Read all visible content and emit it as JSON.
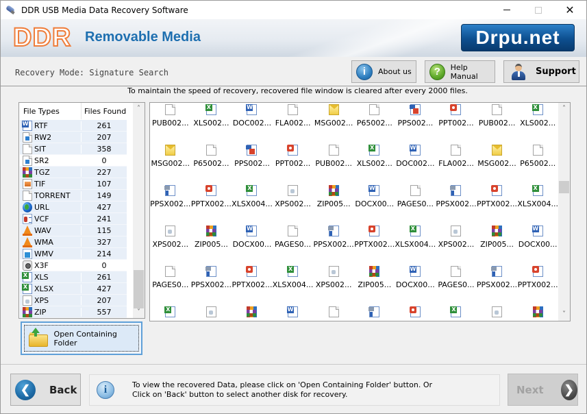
{
  "window": {
    "title": "DDR USB Media Data Recovery Software",
    "controls": {
      "minimize": "minimize",
      "maximize": "maximize",
      "close": "✕"
    }
  },
  "banner": {
    "logo": "DDR",
    "product": "Removable Media",
    "badge": "Drpu.net",
    "colors": {
      "logo_orange": "#ef7d3a",
      "product_blue": "#1e6fb0",
      "badge_blue": "#0d4f8f"
    }
  },
  "mode": {
    "label": "Recovery Mode: Signature Search"
  },
  "toolbar": {
    "about_label": "About us",
    "help_label": "Help Manual",
    "support_label": "Support",
    "about_icon": "i",
    "help_icon": "?"
  },
  "notice": "To maintain the speed of recovery, recovered file window is cleared after every 2000 files.",
  "file_types": {
    "headers": {
      "type": "File Types",
      "count": "Files Found"
    },
    "rows": [
      {
        "type": "RTF",
        "count": "261",
        "icon": "word"
      },
      {
        "type": "RW2",
        "count": "207",
        "icon": "raw"
      },
      {
        "type": "SIT",
        "count": "358",
        "icon": "generic"
      },
      {
        "type": "SR2",
        "count": "0",
        "icon": "raw"
      },
      {
        "type": "TGZ",
        "count": "227",
        "icon": "archive"
      },
      {
        "type": "TIF",
        "count": "107",
        "icon": "image"
      },
      {
        "type": "TORRENT",
        "count": "149",
        "icon": "generic"
      },
      {
        "type": "URL",
        "count": "427",
        "icon": "globe"
      },
      {
        "type": "VCF",
        "count": "241",
        "icon": "vcard"
      },
      {
        "type": "WAV",
        "count": "115",
        "icon": "vlc"
      },
      {
        "type": "WMA",
        "count": "327",
        "icon": "vlc"
      },
      {
        "type": "WMV",
        "count": "214",
        "icon": "video"
      },
      {
        "type": "X3F",
        "count": "0",
        "icon": "camera-raw"
      },
      {
        "type": "XLS",
        "count": "261",
        "icon": "excel"
      },
      {
        "type": "XLSX",
        "count": "427",
        "icon": "excel"
      },
      {
        "type": "XPS",
        "count": "207",
        "icon": "xps"
      },
      {
        "type": "ZIP",
        "count": "557",
        "icon": "archive"
      }
    ],
    "scroll_up": "^",
    "scroll_down": "v"
  },
  "open_folder_label": "Open Containing Folder",
  "recovered_files": [
    {
      "name": "PUB002...",
      "icon": "generic"
    },
    {
      "name": "XLS002...",
      "icon": "excel"
    },
    {
      "name": "DOC002...",
      "icon": "word"
    },
    {
      "name": "FLA002...",
      "icon": "generic"
    },
    {
      "name": "MSG002...",
      "icon": "mail"
    },
    {
      "name": "P65002...",
      "icon": "generic"
    },
    {
      "name": "PPS002...",
      "icon": "pps"
    },
    {
      "name": "PPT002...",
      "icon": "ppt"
    },
    {
      "name": "PUB002...",
      "icon": "generic"
    },
    {
      "name": "XLS002...",
      "icon": "excel"
    },
    {
      "name": "MSG002...",
      "icon": "mail"
    },
    {
      "name": "P65002...",
      "icon": "generic"
    },
    {
      "name": "PPS002...",
      "icon": "pps"
    },
    {
      "name": "PPT002...",
      "icon": "ppt"
    },
    {
      "name": "PUB002...",
      "icon": "generic"
    },
    {
      "name": "XLS002...",
      "icon": "excel"
    },
    {
      "name": "DOC002...",
      "icon": "word"
    },
    {
      "name": "FLA002...",
      "icon": "generic"
    },
    {
      "name": "MSG002...",
      "icon": "mail"
    },
    {
      "name": "P65002...",
      "icon": "generic"
    },
    {
      "name": "PPSX002...",
      "icon": "ppsx"
    },
    {
      "name": "PPTX002...",
      "icon": "ppt"
    },
    {
      "name": "XLSX004...",
      "icon": "excel"
    },
    {
      "name": "XPS002...",
      "icon": "xps"
    },
    {
      "name": "ZIP005...",
      "icon": "archive"
    },
    {
      "name": "DOCX00...",
      "icon": "word"
    },
    {
      "name": "PAGES0...",
      "icon": "generic"
    },
    {
      "name": "PPSX002...",
      "icon": "ppsx"
    },
    {
      "name": "PPTX002...",
      "icon": "ppt"
    },
    {
      "name": "XLSX004...",
      "icon": "excel"
    },
    {
      "name": "XPS002...",
      "icon": "xps"
    },
    {
      "name": "ZIP005...",
      "icon": "archive"
    },
    {
      "name": "DOCX00...",
      "icon": "word"
    },
    {
      "name": "PAGES0...",
      "icon": "generic"
    },
    {
      "name": "PPSX002...",
      "icon": "ppsx"
    },
    {
      "name": "PPTX002...",
      "icon": "ppt"
    },
    {
      "name": "XLSX004...",
      "icon": "excel"
    },
    {
      "name": "XPS002...",
      "icon": "xps"
    },
    {
      "name": "ZIP005...",
      "icon": "archive"
    },
    {
      "name": "DOCX00...",
      "icon": "word"
    },
    {
      "name": "PAGES0...",
      "icon": "generic"
    },
    {
      "name": "PPSX002...",
      "icon": "ppsx"
    },
    {
      "name": "PPTX002...",
      "icon": "ppt"
    },
    {
      "name": "XLSX004...",
      "icon": "excel"
    },
    {
      "name": "XPS002...",
      "icon": "xps"
    },
    {
      "name": "ZIP005...",
      "icon": "archive"
    },
    {
      "name": "DOCX00...",
      "icon": "word"
    },
    {
      "name": "PAGES0...",
      "icon": "generic"
    },
    {
      "name": "PPSX002...",
      "icon": "ppsx"
    },
    {
      "name": "PPTX002...",
      "icon": "ppt"
    },
    {
      "name": "",
      "icon": "excel"
    },
    {
      "name": "",
      "icon": "xps"
    },
    {
      "name": "",
      "icon": "archive"
    },
    {
      "name": "",
      "icon": "word"
    },
    {
      "name": "",
      "icon": "generic"
    },
    {
      "name": "",
      "icon": "ppsx"
    },
    {
      "name": "",
      "icon": "ppt"
    },
    {
      "name": "",
      "icon": "excel"
    },
    {
      "name": "",
      "icon": "xps"
    },
    {
      "name": "",
      "icon": "archive"
    }
  ],
  "footer": {
    "back_label": "Back",
    "next_label": "Next",
    "info_line1": "To view the recovered Data, please click on 'Open Containing Folder' button. Or",
    "info_line2": "Click on 'Back' button to select another disk for recovery.",
    "info_icon": "i"
  }
}
